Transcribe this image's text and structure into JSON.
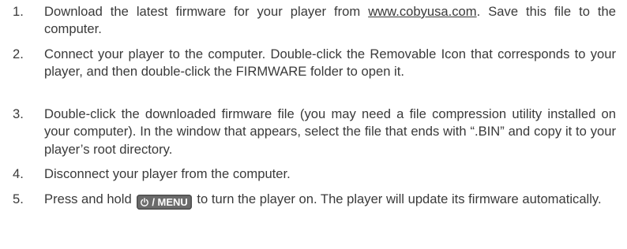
{
  "steps": [
    {
      "number": "1.",
      "before_link": "Download the latest firmware for your player from ",
      "link": "www.cobyusa.com",
      "after_link": ". Save this file to the computer."
    },
    {
      "number": "2.",
      "text": "Connect your player to the computer. Double-click the Removable Icon that corresponds to your player, and then double-click the FIRMWARE folder to open it."
    },
    {
      "number": "3.",
      "text": "Double-click the downloaded firmware file (you may need a file compression utility installed on your computer). In the window that appears, select the file that ends with “.BIN” and copy it to your player’s root directory."
    },
    {
      "number": "4.",
      "text": "Disconnect your player from the computer."
    },
    {
      "number": "5.",
      "before_button": "Press and hold ",
      "button": {
        "icon": "power-icon",
        "label": "/ MENU"
      },
      "after_button": " to turn the player on. The player will update its firmware automatically."
    }
  ]
}
